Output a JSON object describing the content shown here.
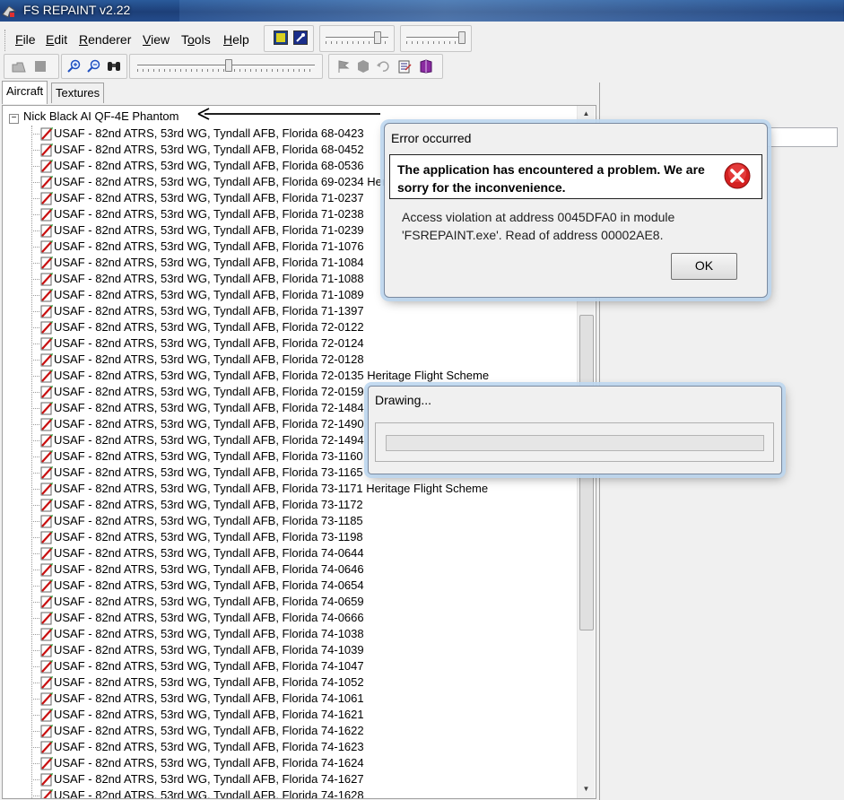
{
  "window": {
    "title": "FS REPAINT v2.22"
  },
  "menu": {
    "items": [
      {
        "label": "File",
        "accel": "F",
        "rest": "ile"
      },
      {
        "label": "Edit",
        "accel": "E",
        "rest": "dit"
      },
      {
        "label": "Renderer",
        "accel": "R",
        "rest": "enderer"
      },
      {
        "label": "View",
        "accel": "V",
        "rest": "iew"
      },
      {
        "label": "Tools",
        "pre": "T",
        "accel": "o",
        "rest": "ols"
      },
      {
        "label": "Help",
        "accel": "H",
        "rest": "elp"
      }
    ]
  },
  "tabs": [
    "Aircraft",
    "Textures"
  ],
  "tree": {
    "root": "Nick Black AI QF-4E Phantom",
    "items": [
      "USAF - 82nd ATRS, 53rd WG, Tyndall AFB, Florida 68-0423",
      "USAF - 82nd ATRS, 53rd WG, Tyndall AFB, Florida 68-0452",
      "USAF - 82nd ATRS, 53rd WG, Tyndall AFB, Florida 68-0536",
      "USAF - 82nd ATRS, 53rd WG, Tyndall AFB, Florida 69-0234 Heritage Flight Scheme",
      "USAF - 82nd ATRS, 53rd WG, Tyndall AFB, Florida 71-0237",
      "USAF - 82nd ATRS, 53rd WG, Tyndall AFB, Florida 71-0238",
      "USAF - 82nd ATRS, 53rd WG, Tyndall AFB, Florida 71-0239",
      "USAF - 82nd ATRS, 53rd WG, Tyndall AFB, Florida 71-1076",
      "USAF - 82nd ATRS, 53rd WG, Tyndall AFB, Florida 71-1084",
      "USAF - 82nd ATRS, 53rd WG, Tyndall AFB, Florida 71-1088",
      "USAF - 82nd ATRS, 53rd WG, Tyndall AFB, Florida 71-1089",
      "USAF - 82nd ATRS, 53rd WG, Tyndall AFB, Florida 71-1397",
      "USAF - 82nd ATRS, 53rd WG, Tyndall AFB, Florida 72-0122",
      "USAF - 82nd ATRS, 53rd WG, Tyndall AFB, Florida 72-0124",
      "USAF - 82nd ATRS, 53rd WG, Tyndall AFB, Florida 72-0128",
      "USAF - 82nd ATRS, 53rd WG, Tyndall AFB, Florida 72-0135 Heritage Flight Scheme",
      "USAF - 82nd ATRS, 53rd WG, Tyndall AFB, Florida 72-0159",
      "USAF - 82nd ATRS, 53rd WG, Tyndall AFB, Florida 72-1484",
      "USAF - 82nd ATRS, 53rd WG, Tyndall AFB, Florida 72-1490",
      "USAF - 82nd ATRS, 53rd WG, Tyndall AFB, Florida 72-1494",
      "USAF - 82nd ATRS, 53rd WG, Tyndall AFB, Florida 73-1160",
      "USAF - 82nd ATRS, 53rd WG, Tyndall AFB, Florida 73-1165",
      "USAF - 82nd ATRS, 53rd WG, Tyndall AFB, Florida 73-1171 Heritage Flight Scheme",
      "USAF - 82nd ATRS, 53rd WG, Tyndall AFB, Florida 73-1172",
      "USAF - 82nd ATRS, 53rd WG, Tyndall AFB, Florida 73-1185",
      "USAF - 82nd ATRS, 53rd WG, Tyndall AFB, Florida 73-1198",
      "USAF - 82nd ATRS, 53rd WG, Tyndall AFB, Florida 74-0644",
      "USAF - 82nd ATRS, 53rd WG, Tyndall AFB, Florida 74-0646",
      "USAF - 82nd ATRS, 53rd WG, Tyndall AFB, Florida 74-0654",
      "USAF - 82nd ATRS, 53rd WG, Tyndall AFB, Florida 74-0659",
      "USAF - 82nd ATRS, 53rd WG, Tyndall AFB, Florida 74-0666",
      "USAF - 82nd ATRS, 53rd WG, Tyndall AFB, Florida 74-1038",
      "USAF - 82nd ATRS, 53rd WG, Tyndall AFB, Florida 74-1039",
      "USAF - 82nd ATRS, 53rd WG, Tyndall AFB, Florida 74-1047",
      "USAF - 82nd ATRS, 53rd WG, Tyndall AFB, Florida 74-1052",
      "USAF - 82nd ATRS, 53rd WG, Tyndall AFB, Florida 74-1061",
      "USAF - 82nd ATRS, 53rd WG, Tyndall AFB, Florida 74-1621",
      "USAF - 82nd ATRS, 53rd WG, Tyndall AFB, Florida 74-1622",
      "USAF - 82nd ATRS, 53rd WG, Tyndall AFB, Florida 74-1623",
      "USAF - 82nd ATRS, 53rd WG, Tyndall AFB, Florida 74-1624",
      "USAF - 82nd ATRS, 53rd WG, Tyndall AFB, Florida 74-1627",
      "USAF - 82nd ATRS, 53rd WG, Tyndall AFB, Florida 74-1628"
    ]
  },
  "error_dialog": {
    "caption": "Error occurred",
    "headline": "The application has encountered a problem. We are sorry for the inconvenience.",
    "detail": "Access violation at address 0045DFA0 in module 'FSREPAINT.exe'. Read of address 00002AE8.",
    "ok_label": "OK"
  },
  "drawing_dialog": {
    "caption": "Drawing...",
    "progress": 0
  },
  "colors": {
    "titlebar": "#1d3f78",
    "error_icon": "#d42020",
    "tree_icon_red": "#c81010",
    "tree_icon_green": "#2f8f2f"
  }
}
